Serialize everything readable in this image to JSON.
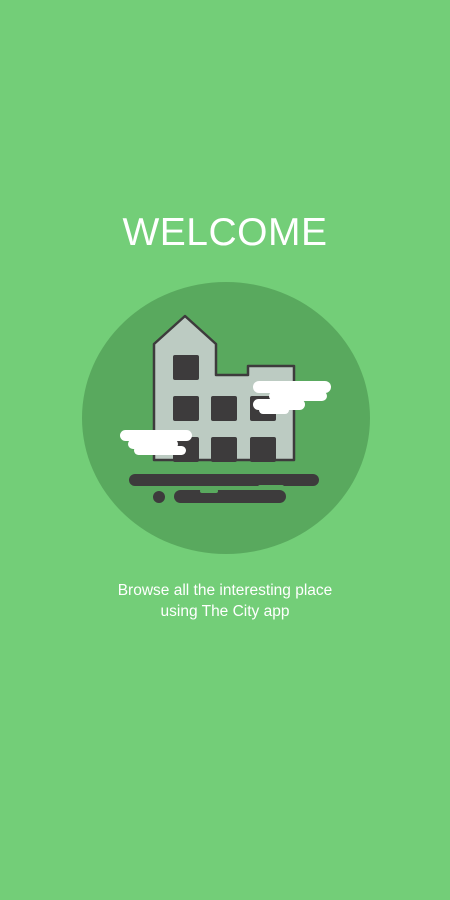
{
  "welcome": {
    "title": "WELCOME",
    "caption_line1": "Browse all the interesting place",
    "caption_line2": "using The City app"
  },
  "illustration": {
    "icon": "city-building-illustration",
    "colors": {
      "background": "#73ce78",
      "circle": "#59a95e",
      "building": "#bccbc2",
      "outline": "#3d3b3c",
      "window": "#3d3b3c",
      "cloud": "#ffffff"
    }
  }
}
